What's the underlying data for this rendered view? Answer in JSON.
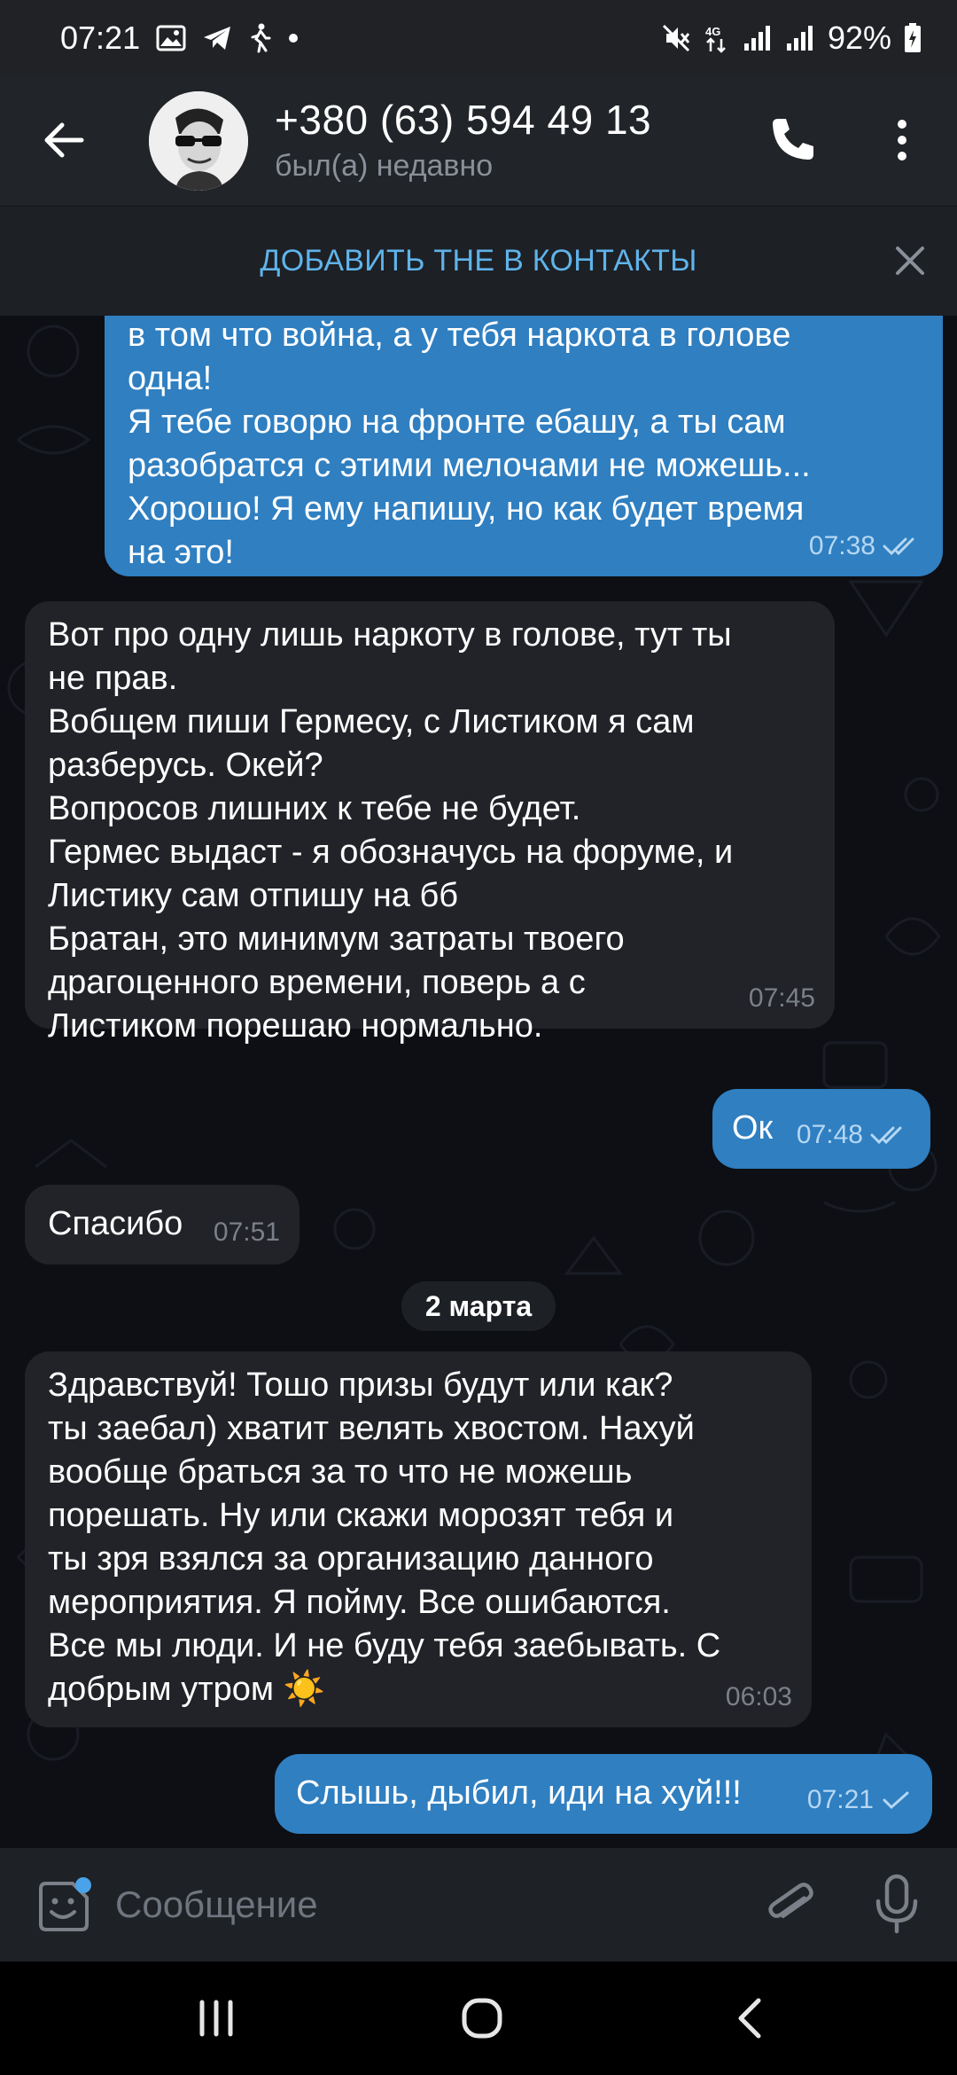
{
  "status_bar": {
    "time": "07:21",
    "battery": "92%",
    "network": "4G"
  },
  "header": {
    "contact_name": "+380 (63) 594 49 13",
    "contact_status": "был(а) недавно"
  },
  "add_contact_bar": {
    "label": "ДОБАВИТЬ THE В КОНТАКТЫ"
  },
  "messages": [
    {
      "direction": "out",
      "text": "в том что война, а у тебя наркота в голове\nодна!\nЯ тебе говорю на фронте ебашу, а ты сам\nразобратся с этими мелочами не можешь...\nХорошо! Я ему напишу, но как будет время\nна это!",
      "time": "07:38",
      "status": "read"
    },
    {
      "direction": "in",
      "text": "Вот про одну лишь наркоту в голове, тут ты\nне прав.\nВобщем пиши Гермесу, с Листиком я сам\nразберусь. Окей?\nВопросов лишних к тебе не будет.\nГермес выдаст - я обозначусь на форуме, и\nЛистику сам отпишу на бб\nБратан, это минимум затраты твоего\nдрагоценного времени, поверь а с\nЛистиком порешаю нормально.",
      "time": "07:45"
    },
    {
      "direction": "out",
      "text": "Ок",
      "time": "07:48",
      "status": "read"
    },
    {
      "direction": "in",
      "text": "Спасибо",
      "time": "07:51"
    },
    {
      "direction": "in",
      "text": "Здравствуй! Тошо призы будут или как?\nты заебал) хватит велять хвостом. Нахуй\nвообще браться за то что не можешь\nпорешать.  Ну или скажи морозят тебя и\nты зря взялся за организацию данного\nмероприятия.  Я пойму. Все ошибаются.\nВсе мы люди. И не буду тебя заебывать. С\nдобрым утром ☀️",
      "time": "06:03"
    },
    {
      "direction": "out",
      "text": "Слышь, дыбил, иди на хуй!!!",
      "time": "07:21",
      "status": "sent"
    }
  ],
  "date_separator": "2 марта",
  "input": {
    "placeholder": "Сообщение",
    "value": ""
  },
  "icons": {
    "back": "arrow-left-icon",
    "call": "phone-icon",
    "menu": "more-vertical-icon",
    "close": "close-icon",
    "emoji": "sticker-emoji-icon",
    "attach": "paperclip-icon",
    "mic": "microphone-icon"
  },
  "colors": {
    "accent": "#5fb3ea",
    "outgoing_bubble": "#2f7fc1",
    "incoming_bubble": "#212328",
    "chat_background": "#0d0f14",
    "header": "#212429"
  }
}
